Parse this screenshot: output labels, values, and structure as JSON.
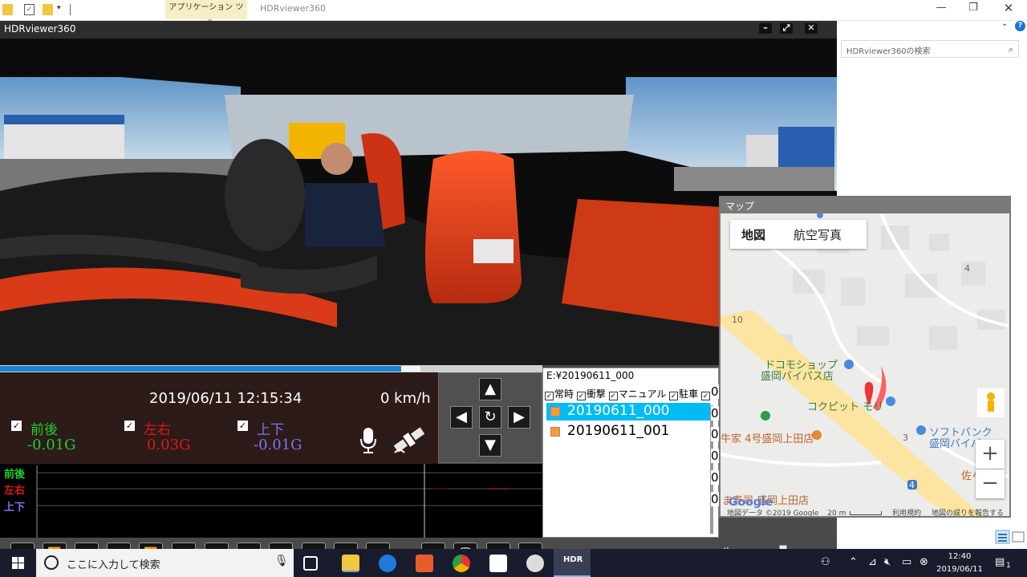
{
  "explorer": {
    "context_tab": "アプリケーション ツール",
    "window_tab": "HDRviewer360",
    "search_placeholder": "HDRviewer360の検索"
  },
  "app": {
    "title": "HDRviewer360",
    "status": {
      "datetime": "2019/06/11 12:15:34",
      "speed": "0 km/h"
    },
    "progress": 0.74,
    "gsensor": [
      {
        "label": "前後",
        "value": "-0.01G",
        "color": "#1ed12f",
        "checked": true
      },
      {
        "label": "左右",
        "value": "0.03G",
        "color": "#e01616",
        "checked": true
      },
      {
        "label": "上下",
        "value": "-0.01G",
        "color": "#7878f0",
        "checked": true
      }
    ],
    "graph_labels": {
      "fb": "前後",
      "lr": "左右",
      "ud": "上下"
    },
    "file_panel": {
      "path": "E:¥20190611_000",
      "filters": [
        "常時",
        "衝撃",
        "マニュアル",
        "駐車"
      ],
      "files": [
        "20190611_000",
        "20190611_001"
      ],
      "selected_index": 0,
      "side_values": [
        "0",
        "0",
        "0",
        "0",
        "0",
        "0"
      ]
    },
    "volume": 0.42
  },
  "map": {
    "title": "マップ",
    "tabs": {
      "map": "地図",
      "aerial": "航空写真"
    },
    "places": {
      "docomo_line1": "ドコモショップ",
      "docomo_line2": "盛岡バイパス店",
      "cockpit": "コクピット モリ",
      "softbank_line1": "ソフトバンク",
      "softbank_line2": "盛岡バイパ",
      "yoshinoya": "牛家 4号盛岡上田店",
      "sushi": "ま寿司 盛岡上田店",
      "sasaki": "佐々",
      "num_10": "10",
      "num_4a": "4",
      "num_3": "3",
      "num_4b": "4"
    },
    "attribution": {
      "data": "地図データ ©2019 Google",
      "scale": "20 m",
      "terms": "利用規約",
      "report": "地図の誤りを報告する"
    },
    "logo": "Google"
  },
  "taskbar": {
    "search": "ここに入力して検索",
    "hdr_app": "HDR",
    "time": "12:40",
    "date": "2019/06/11",
    "notification_count": "1"
  },
  "colors": {
    "titlebar": "#2e2e2e",
    "progress": "#1d83cf",
    "file_selected": "#00bcf2",
    "taskbar": "#181c2c"
  }
}
